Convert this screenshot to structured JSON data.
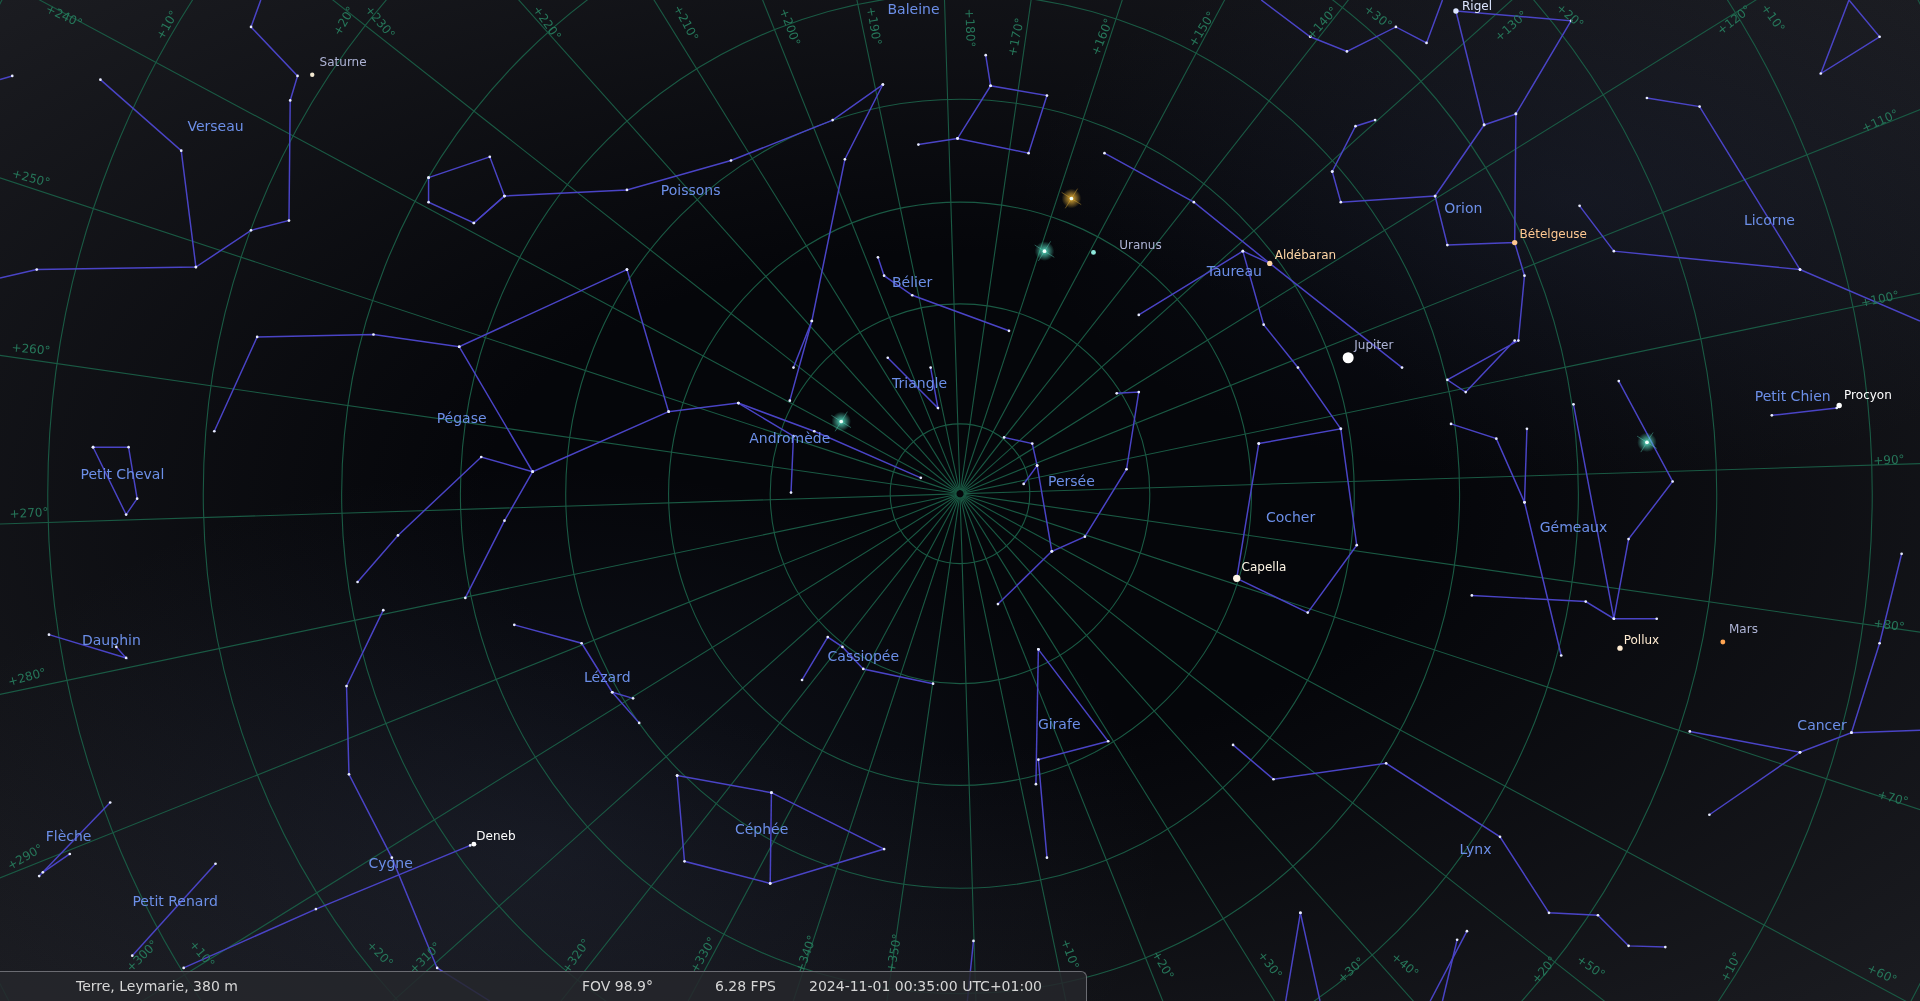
{
  "constellations": [
    "Baleine",
    "Verseau",
    "Poissons",
    "Bélier",
    "Taureau",
    "Orion",
    "Licorne",
    "Pégase",
    "Triangle",
    "Andromède",
    "Petit Cheval",
    "Persée",
    "Petit Chien",
    "Cocher",
    "Gémeaux",
    "Dauphin",
    "Cassiopée",
    "Lézard",
    "Girafe",
    "Cancer",
    "Flèche",
    "Céphée",
    "Lynx",
    "Cygne",
    "Petit Renard"
  ],
  "objects": [
    {
      "name": "Rigel",
      "kind": "star",
      "color": "#dde6ff"
    },
    {
      "name": "Saturne",
      "kind": "planet",
      "color": "#f2e8d0"
    },
    {
      "name": "Bételgeuse",
      "kind": "star",
      "color": "#ffc891"
    },
    {
      "name": "Uranus",
      "kind": "planet",
      "color": "#8ee8dc"
    },
    {
      "name": "Aldébaran",
      "kind": "star",
      "color": "#ffd6a6"
    },
    {
      "name": "Jupiter",
      "kind": "planet",
      "color": "#ffffff"
    },
    {
      "name": "Procyon",
      "kind": "star",
      "color": "#ffffff"
    },
    {
      "name": "Capella",
      "kind": "star",
      "color": "#fff6e6"
    },
    {
      "name": "Mars",
      "kind": "planet",
      "color": "#ffa552"
    },
    {
      "name": "Pollux",
      "kind": "star",
      "color": "#ffecd2"
    },
    {
      "name": "Deneb",
      "kind": "star",
      "color": "#ffffff"
    }
  ],
  "grid_labels": [
    "+240°",
    "+10°",
    "+20°",
    "+230°",
    "+220°",
    "+210°",
    "+200°",
    "+190°",
    "+180°",
    "+170°",
    "+160°",
    "+150°",
    "+140°",
    "+30°",
    "+130°",
    "+20°",
    "+120°",
    "+10°",
    "+250°",
    "+260°",
    "+270°",
    "+280°",
    "+290°",
    "+110°",
    "+100°",
    "+90°",
    "+80°",
    "+70°",
    "+300°",
    "+10°",
    "+20°",
    "+310°",
    "+320°",
    "+330°",
    "+340°",
    "+350°",
    "+10°",
    "+20°",
    "+30°",
    "+30°",
    "+40°",
    "+20°",
    "+50°",
    "+10°",
    "+60°"
  ],
  "status_bar": {
    "location": "Terre, Leymarie, 380 m",
    "fov": "FOV 98.9°",
    "fps": "6.28 FPS",
    "datetime": "2024-11-01 00:35:00 UTC+01:00"
  }
}
